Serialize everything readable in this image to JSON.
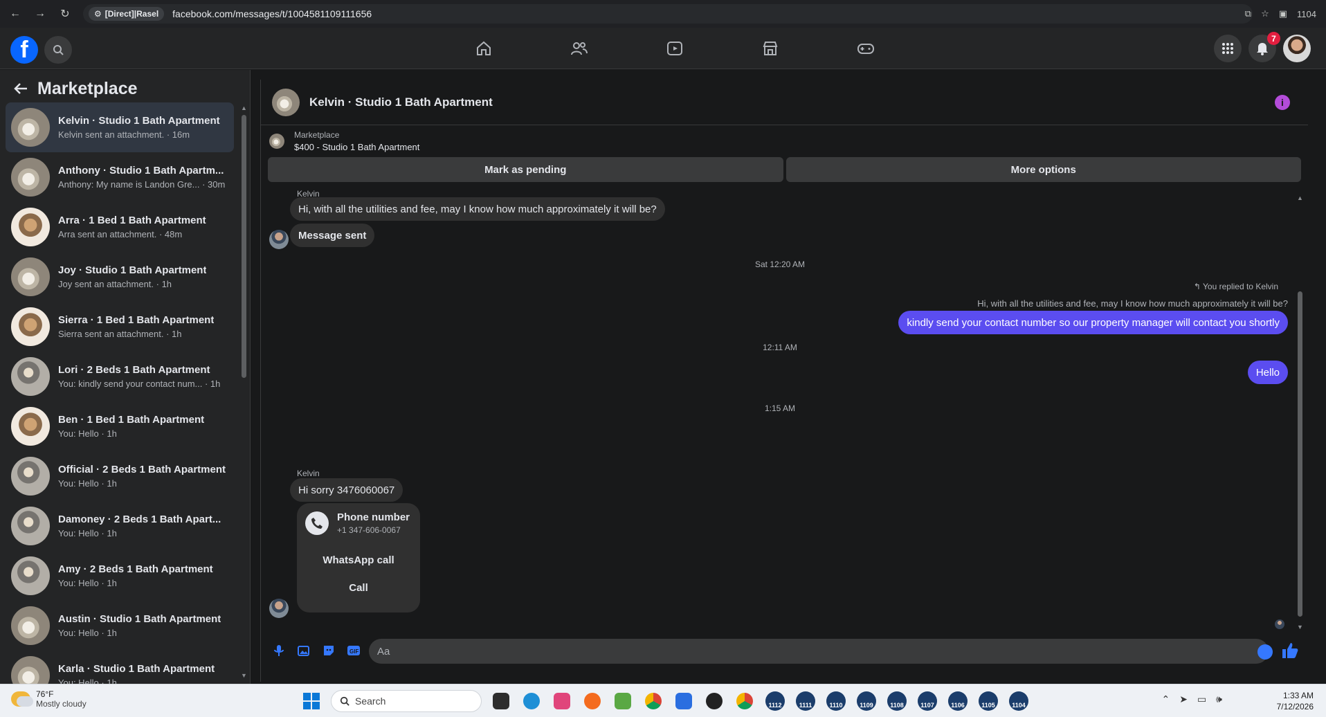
{
  "browser": {
    "site_chip": "[Direct]|Rasel",
    "url": "facebook.com/messages/t/1004581109111656",
    "tab_count": "1104"
  },
  "fb_nav": {
    "notifications_count": "7"
  },
  "sidebar": {
    "title": "Marketplace",
    "conversations": [
      {
        "title": "Kelvin · Studio 1 Bath Apartment",
        "subtitle": "Kelvin sent an attachment. · 16m",
        "thumb": "studio",
        "active": true
      },
      {
        "title": "Anthony · Studio 1 Bath Apartm...",
        "subtitle": "Anthony: My name is Landon Gre... · 30m",
        "thumb": "studio"
      },
      {
        "title": "Arra · 1 Bed 1 Bath Apartment",
        "subtitle": "Arra sent an attachment. · 48m",
        "thumb": "bed"
      },
      {
        "title": "Joy · Studio 1 Bath Apartment",
        "subtitle": "Joy sent an attachment. · 1h",
        "thumb": "studio"
      },
      {
        "title": "Sierra · 1 Bed 1 Bath Apartment",
        "subtitle": "Sierra sent an attachment. · 1h",
        "thumb": "bed"
      },
      {
        "title": "Lori · 2 Beds 1 Bath Apartment",
        "subtitle": "You: kindly send your contact num... · 1h",
        "thumb": "fan"
      },
      {
        "title": "Ben · 1 Bed 1 Bath Apartment",
        "subtitle": "You: Hello · 1h",
        "thumb": "bed"
      },
      {
        "title": "Official · 2 Beds 1 Bath Apartment",
        "subtitle": "You: Hello · 1h",
        "thumb": "fan"
      },
      {
        "title": "Damoney · 2 Beds 1 Bath Apart...",
        "subtitle": "You: Hello · 1h",
        "thumb": "fan"
      },
      {
        "title": "Amy · 2 Beds 1 Bath Apartment",
        "subtitle": "You: Hello · 1h",
        "thumb": "fan"
      },
      {
        "title": "Austin · Studio 1 Bath Apartment",
        "subtitle": "You: Hello · 1h",
        "thumb": "studio"
      },
      {
        "title": "Karla · Studio 1 Bath Apartment",
        "subtitle": "You: Hello · 1h",
        "thumb": "studio"
      }
    ]
  },
  "chat": {
    "title": "Kelvin · Studio 1 Bath Apartment",
    "listing_label": "Marketplace",
    "listing_price": "$400 - Studio 1 Bath Apartment",
    "mark_pending": "Mark as pending",
    "more_options": "More options",
    "sender": "Kelvin",
    "msg1": "Hi, with all the utilities and fee, may I know how much approximately it will be?",
    "msg2": "Message sent",
    "ts1": "Sat 12:20 AM",
    "reply_note": "You replied to Kelvin",
    "quoted": "Hi, with all the utilities and fee, may I know how much approximately it will be?",
    "out1": "kindly send your contact number so our property manager will contact you shortly",
    "ts2": "12:11 AM",
    "out2": "Hello",
    "ts3": "1:15 AM",
    "sender2": "Kelvin",
    "msg3": "Hi sorry 3476060067",
    "phone_title": "Phone number",
    "phone_number": "+1 347-606-0067",
    "whatsapp": "WhatsApp call",
    "call": "Call",
    "composer_placeholder": "Aa"
  },
  "taskbar": {
    "temp": "76°F",
    "weather": "Mostly cloudy",
    "search": "Search",
    "badges": [
      "1112",
      "1111",
      "1110",
      "1109",
      "1108",
      "1107",
      "1106",
      "1105",
      "1104"
    ],
    "time": "1:33 AM",
    "date": "7/12/2026"
  }
}
